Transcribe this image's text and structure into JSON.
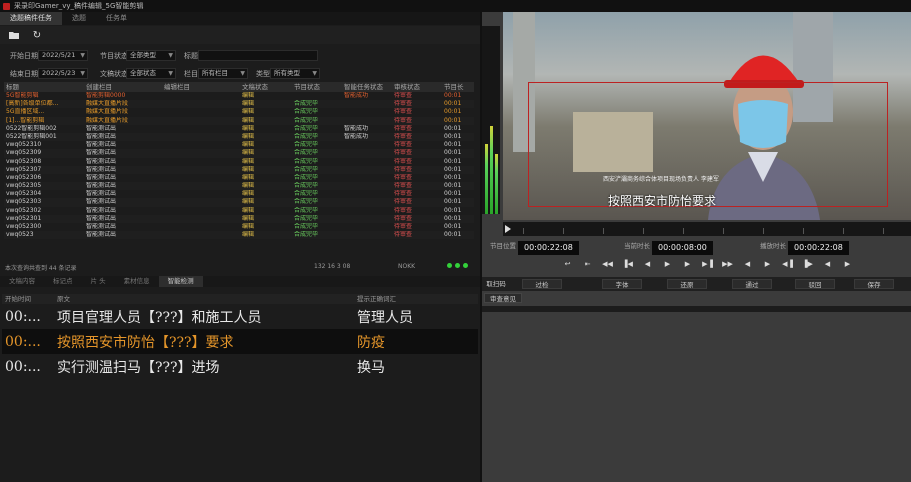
{
  "window": {
    "title": "采录印Gamer_vy_稿件编辑_5G智能剪辑"
  },
  "tabs": [
    {
      "label": "选题稿件任务",
      "active": true
    },
    {
      "label": "选题",
      "active": false
    },
    {
      "label": "任务单",
      "active": false
    }
  ],
  "filters": {
    "start_label": "开始日期",
    "start_value": "2022/5/21",
    "status_label": "节目状态",
    "status_value": "全部类型",
    "title_label": "标题",
    "end_label": "结束日期",
    "end_value": "2022/5/23",
    "doc_label": "文稿状态",
    "doc_value": "全部状态",
    "column_label": "栏目",
    "column_value": "所有栏目",
    "type_label": "类型",
    "type_value": "所有类型"
  },
  "table": {
    "headers": [
      "标题",
      "创建栏目",
      "编辑栏目",
      "文稿状态",
      "节目状态",
      "智能任务状态",
      "审核状态",
      "节目长"
    ],
    "rows": [
      {
        "title": "5G智能剪辑",
        "creator": "智能剪辑0000",
        "editor": "",
        "doc": "编辑",
        "prog": "",
        "smart": "智能成功",
        "review": "待审查",
        "len": "00:01",
        "style": "sel"
      },
      {
        "title": "[高新]各级单位都...",
        "creator": "融媒大直播片段",
        "editor": "",
        "doc": "编辑",
        "prog": "合成完毕",
        "smart": "",
        "review": "待审查",
        "len": "00:01",
        "style": "hl"
      },
      {
        "title": "5G直播区域...",
        "creator": "融媒大直播片段",
        "editor": "",
        "doc": "编辑",
        "prog": "合成完毕",
        "smart": "",
        "review": "待审查",
        "len": "00:01",
        "style": "hl"
      },
      {
        "title": "[1]...智能剪辑",
        "creator": "融媒大直播片段",
        "editor": "",
        "doc": "编辑",
        "prog": "合成完毕",
        "smart": "",
        "review": "待审查",
        "len": "00:01",
        "style": "hl"
      },
      {
        "title": "0522智能剪辑002",
        "creator": "智能测试出",
        "editor": "",
        "doc": "编辑",
        "prog": "合成完毕",
        "smart": "智能成功",
        "review": "待审查",
        "len": "00:01",
        "style": ""
      },
      {
        "title": "0522智能剪辑001",
        "creator": "智能测试出",
        "editor": "",
        "doc": "编辑",
        "prog": "合成完毕",
        "smart": "智能成功",
        "review": "待审查",
        "len": "00:01",
        "style": ""
      },
      {
        "title": "vwq052310",
        "creator": "智能测试出",
        "editor": "",
        "doc": "编辑",
        "prog": "合成完毕",
        "smart": "",
        "review": "待审查",
        "len": "00:01",
        "style": ""
      },
      {
        "title": "vwq052309",
        "creator": "智能测试出",
        "editor": "",
        "doc": "编辑",
        "prog": "合成完毕",
        "smart": "",
        "review": "待审查",
        "len": "00:01",
        "style": ""
      },
      {
        "title": "vwq052308",
        "creator": "智能测试出",
        "editor": "",
        "doc": "编辑",
        "prog": "合成完毕",
        "smart": "",
        "review": "待审查",
        "len": "00:01",
        "style": ""
      },
      {
        "title": "vwq052307",
        "creator": "智能测试出",
        "editor": "",
        "doc": "编辑",
        "prog": "合成完毕",
        "smart": "",
        "review": "待审查",
        "len": "00:01",
        "style": ""
      },
      {
        "title": "vwq052306",
        "creator": "智能测试出",
        "editor": "",
        "doc": "编辑",
        "prog": "合成完毕",
        "smart": "",
        "review": "待审查",
        "len": "00:01",
        "style": ""
      },
      {
        "title": "vwq052305",
        "creator": "智能测试出",
        "editor": "",
        "doc": "编辑",
        "prog": "合成完毕",
        "smart": "",
        "review": "待审查",
        "len": "00:01",
        "style": ""
      },
      {
        "title": "vwq052304",
        "creator": "智能测试出",
        "editor": "",
        "doc": "编辑",
        "prog": "合成完毕",
        "smart": "",
        "review": "待审查",
        "len": "00:01",
        "style": ""
      },
      {
        "title": "vwq052303",
        "creator": "智能测试出",
        "editor": "",
        "doc": "编辑",
        "prog": "合成完毕",
        "smart": "",
        "review": "待审查",
        "len": "00:01",
        "style": ""
      },
      {
        "title": "vwq052302",
        "creator": "智能测试出",
        "editor": "",
        "doc": "编辑",
        "prog": "合成完毕",
        "smart": "",
        "review": "待审查",
        "len": "00:01",
        "style": ""
      },
      {
        "title": "vwq052301",
        "creator": "智能测试出",
        "editor": "",
        "doc": "编辑",
        "prog": "合成完毕",
        "smart": "",
        "review": "待审查",
        "len": "00:01",
        "style": ""
      },
      {
        "title": "vwq052300",
        "creator": "智能测试出",
        "editor": "",
        "doc": "编辑",
        "prog": "合成完毕",
        "smart": "",
        "review": "待审查",
        "len": "00:01",
        "style": ""
      },
      {
        "title": "vwq0523",
        "creator": "智能测试出",
        "editor": "",
        "doc": "编辑",
        "prog": "合成完毕",
        "smart": "",
        "review": "待审查",
        "len": "00:01",
        "style": ""
      }
    ]
  },
  "status": {
    "left": "本次查询共查到 44 条记录",
    "mid": "132 16 3 08",
    "mid2": "NOKK"
  },
  "bottom_tabs": [
    {
      "label": "文稿内容",
      "active": false
    },
    {
      "label": "标记点",
      "active": false
    },
    {
      "label": "片 头",
      "active": false
    },
    {
      "label": "素材信息",
      "active": false
    },
    {
      "label": "智能检测",
      "active": true
    }
  ],
  "subtitles": {
    "headers": [
      "开始时间",
      "原文",
      "提示正确词汇"
    ],
    "rows": [
      {
        "time": "00:...",
        "text": "项目官理人员【???】和施工人员",
        "hint": "管理人员",
        "selected": false
      },
      {
        "time": "00:...",
        "text": "按照西安市防怡【???】要求",
        "hint": "防疫",
        "selected": true
      },
      {
        "time": "00:...",
        "text": "实行测温扫马【???】进场",
        "hint": "换马",
        "selected": false
      }
    ]
  },
  "video": {
    "caption_small": "西安浐灞商务综合体项目现场负责人 李建军",
    "caption_large": "按照西安市防怡要求"
  },
  "timecodes": {
    "position_label": "节目位置",
    "position": "00:00:22:08",
    "mark_label": "当前时长",
    "mark": "00:00:08:00",
    "duration_label": "播放时长",
    "duration": "00:00:22:08"
  },
  "actions": [
    "取扫码",
    "过检",
    "字体",
    "还原",
    "通过",
    "驳回",
    "保存"
  ],
  "review_button": "审查意见",
  "colors": {
    "accent_orange": "#e4952a",
    "ok_green": "#6bcf5f",
    "status_dot": "#33d13a"
  }
}
